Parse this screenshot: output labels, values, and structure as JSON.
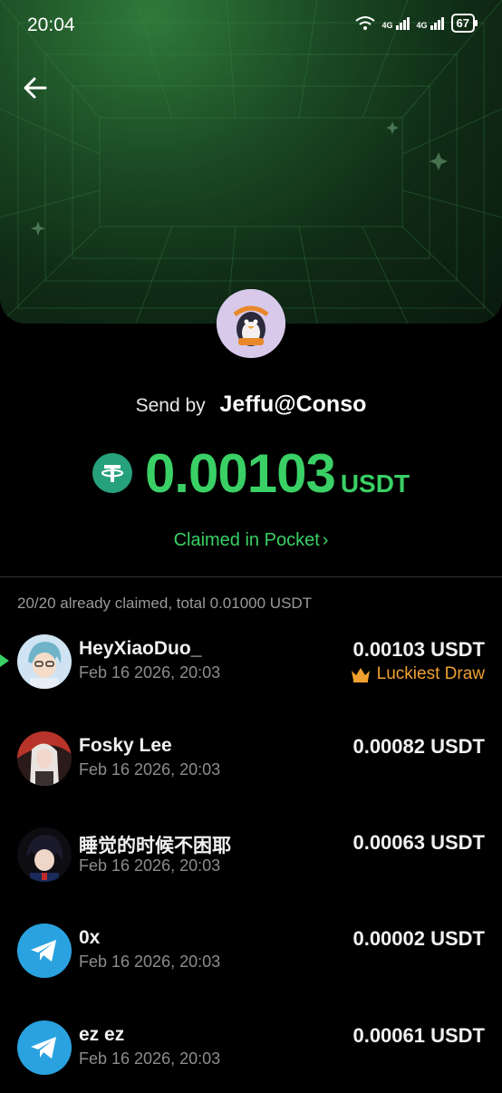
{
  "status_bar": {
    "time": "20:04",
    "battery": "67",
    "network_1": "4G",
    "network_2": "4G"
  },
  "header": {
    "back_icon": "arrow-left-icon"
  },
  "sender": {
    "label": "Send by",
    "name": "Jeffu@Conso"
  },
  "envelope": {
    "amount": "0.00103",
    "unit": "USDT",
    "claimed_link": "Claimed in Pocket"
  },
  "summary": "20/20 already claimed, total 0.01000 USDT",
  "claims": [
    {
      "name": "HeyXiaoDuo_",
      "date": "Feb 16 2026, 20:03",
      "amount": "0.00103 USDT",
      "badge": "Luckiest Draw"
    },
    {
      "name": "Fosky Lee",
      "date": "Feb 16 2026, 20:03",
      "amount": "0.00082 USDT"
    },
    {
      "name": "睡觉的时候不困耶",
      "date": "Feb 16 2026, 20:03",
      "amount": "0.00063 USDT"
    },
    {
      "name": "0x",
      "date": "Feb 16 2026, 20:03",
      "amount": "0.00002 USDT"
    },
    {
      "name": "ez ez",
      "date": "Feb 16 2026, 20:03",
      "amount": "0.00061 USDT"
    }
  ],
  "colors": {
    "accent": "#3ad065",
    "tether": "#26a17b",
    "badge": "#f0a030",
    "telegram": "#2aa2e0"
  }
}
